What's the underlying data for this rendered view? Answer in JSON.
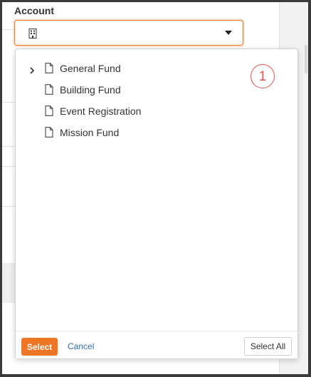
{
  "field": {
    "label": "Account",
    "icon": "building-icon",
    "caret_icon": "caret-down-icon"
  },
  "dropdown": {
    "items": [
      {
        "name": "General Fund",
        "has_children": true
      },
      {
        "name": "Building Fund",
        "has_children": false
      },
      {
        "name": "Event Registration",
        "has_children": false
      },
      {
        "name": "Mission Fund",
        "has_children": false
      }
    ],
    "item_icon": "file-icon",
    "expand_icon": "chevron-right-icon",
    "annotation_badge": "1"
  },
  "footer": {
    "select_label": "Select",
    "cancel_label": "Cancel",
    "select_all_label": "Select All"
  },
  "colors": {
    "accent": "#ee7625",
    "link": "#2f6fb5",
    "badge": "#e05050"
  }
}
